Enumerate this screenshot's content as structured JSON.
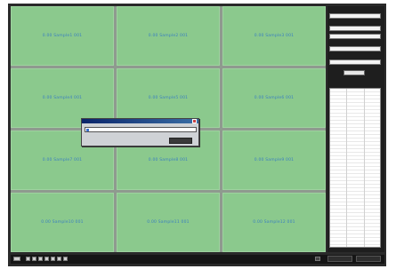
{
  "grid": {
    "cells": [
      "0.00 Sample1 001",
      "0.00 Sample2 001",
      "0.00 Sample3 001",
      "0.00 Sample4 001",
      "0.00 Sample5 001",
      "0.00 Sample6 001",
      "0.00 Sample7 001",
      "0.00 Sample8 001",
      "0.00 Sample9 001",
      "0.00 Sample10 001",
      "0.00 Sample11 001",
      "0.00 Sample12 001"
    ],
    "cell_color": "#8bc98d",
    "label_color": "#3a7fc0"
  },
  "colors": {
    "frame": "#2a2a2a",
    "sidebar": "#1e1e1e",
    "dialog_title": "#0a246a"
  }
}
